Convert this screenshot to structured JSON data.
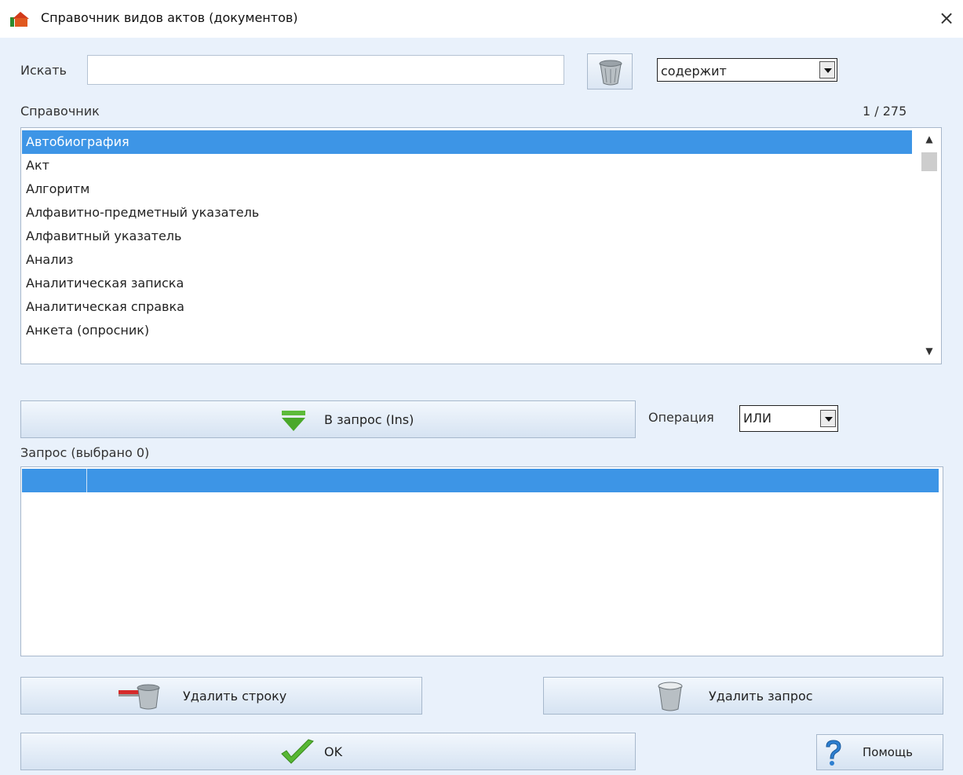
{
  "window": {
    "title": "Справочник видов актов (документов)",
    "close_symbol": "×"
  },
  "search": {
    "label": "Искать",
    "value": "",
    "mode_value": "содержит"
  },
  "directory": {
    "label": "Справочник",
    "counter": "1 / 275",
    "items": [
      "Автобиография",
      "Акт",
      "Алгоритм",
      "Алфавитно-предметный указатель",
      "Алфавитный указатель",
      "Анализ",
      "Аналитическая записка",
      "Аналитическая справка",
      "Анкета (опросник)"
    ],
    "selected_index": 0
  },
  "add_to_query": {
    "label": "В запрос (Ins)"
  },
  "operation": {
    "label": "Операция",
    "value": "ИЛИ"
  },
  "query": {
    "label": "Запрос (выбрано 0)",
    "rows": [
      [
        "",
        ""
      ]
    ]
  },
  "actions": {
    "delete_row": "Удалить строку",
    "delete_query": "Удалить запрос",
    "ok": "OK",
    "help": "Помощь"
  },
  "colors": {
    "accent": "#3d95e6",
    "background": "#e9f1fb",
    "button_border": "#a7b8cc"
  },
  "icons": [
    "app-icon",
    "close-icon",
    "trash-clear-icon",
    "dropdown-arrow-icon",
    "arrow-down-green-icon",
    "delete-row-icon",
    "trash-icon",
    "checkmark-icon",
    "help-icon"
  ]
}
